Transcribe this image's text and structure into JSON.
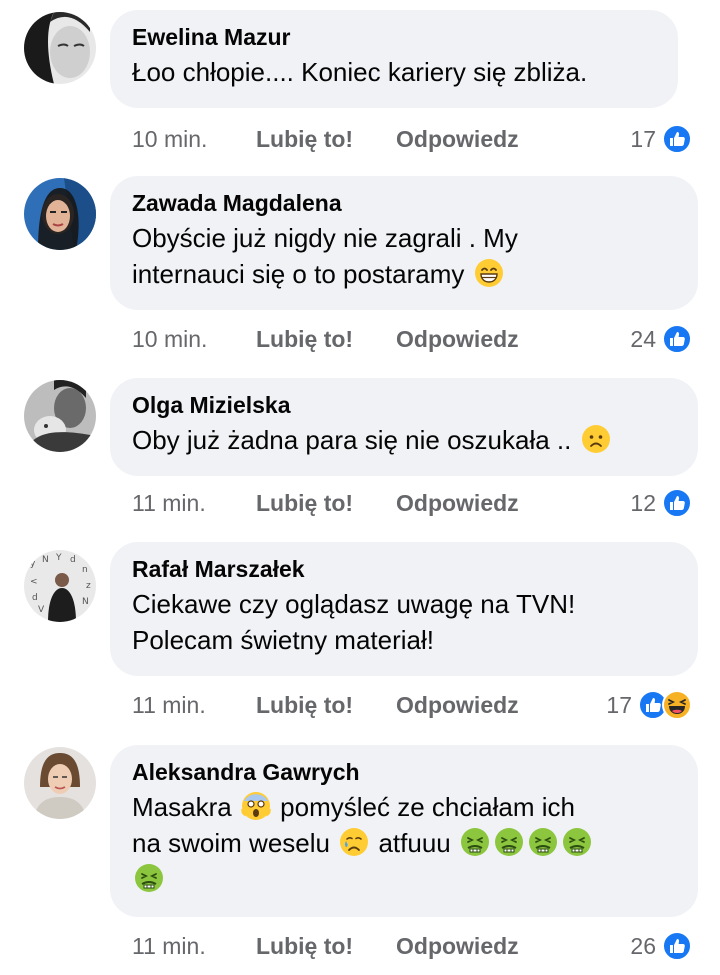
{
  "colors": {
    "like_blue": "#1877f2",
    "bubble_bg": "#f0f2f5",
    "meta_gray": "#65676b"
  },
  "comments": [
    {
      "author": "Ewelina Mazur",
      "text": "Łoo chłopie.... Koniec kariery się zbliża.",
      "time": "10 min.",
      "like_label": "Lubię to!",
      "reply_label": "Odpowiedz",
      "reaction_count": "17",
      "reactions": [
        "like-icon"
      ]
    },
    {
      "author": "Zawada Magdalena",
      "text_line1": "Obyście już nigdy nie zagrali . My",
      "text_line2": "internauci się o to postaramy",
      "emoji": "grinning-face-icon",
      "time": "10 min.",
      "like_label": "Lubię to!",
      "reply_label": "Odpowiedz",
      "reaction_count": "24",
      "reactions": [
        "like-icon"
      ]
    },
    {
      "author": "Olga Mizielska",
      "text": "Oby już żadna para się nie oszukała ..",
      "emoji": "frowning-face-icon",
      "time": "11 min.",
      "like_label": "Lubię to!",
      "reply_label": "Odpowiedz",
      "reaction_count": "12",
      "reactions": [
        "like-icon"
      ]
    },
    {
      "author": "Rafał Marszałek",
      "text_line1": "Ciekawe czy oglądasz uwagę na TVN!",
      "text_line2": "Polecam świetny materiał!",
      "time": "11 min.",
      "like_label": "Lubię to!",
      "reply_label": "Odpowiedz",
      "reaction_count": "17",
      "reactions": [
        "like-icon",
        "haha-icon"
      ]
    },
    {
      "author": "Aleksandra Gawrych",
      "text_part1": "Masakra",
      "text_part2": "pomyśleć ze chciałam ich",
      "text_part3": "na swoim weselu",
      "text_part4": "atfuuu",
      "emoji_scream": "screaming-face-icon",
      "emoji_sad": "sad-tear-face-icon",
      "emoji_nauseated": "nauseated-face-icon",
      "time": "11 min.",
      "like_label": "Lubię to!",
      "reply_label": "Odpowiedz",
      "reaction_count": "26",
      "reactions": [
        "like-icon"
      ]
    }
  ]
}
